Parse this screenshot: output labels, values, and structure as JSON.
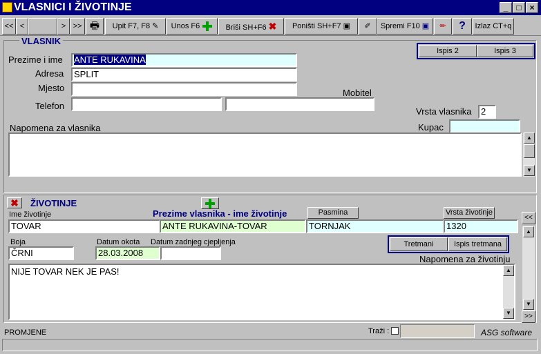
{
  "window": {
    "title": "VLASNICI I ŽIVOTINJE"
  },
  "toolbar": {
    "first": "<<",
    "prev": "<",
    "next": ">",
    "last": ">>",
    "query": "Upit F7, F8",
    "insert": "Unos F6",
    "delete": "Briši  SH+F6",
    "cancel": "Poništi SH+F7",
    "save": "Spremi F10",
    "exit": "Izlaz CT+q"
  },
  "owner": {
    "section": "VLASNIK",
    "print2": "Ispis 2",
    "print3": "Ispis 3",
    "name_label": "Prezime i ime",
    "name": "ANTE RUKAVINA",
    "address_label": "Adresa",
    "address": "SPLIT",
    "city_label": "Mjesto",
    "city": "",
    "mobile_label": "Mobitel",
    "phone_label": "Telefon",
    "phone": "",
    "mobile": "",
    "type_label": "Vrsta vlasnika",
    "type": "2",
    "buyer_label": "Kupac",
    "buyer": "",
    "note_label": "Napomena za vlasnika",
    "note": ""
  },
  "animals": {
    "section": "ŽIVOTINJE",
    "name_label": "Ime životinje",
    "name": "TOVAR",
    "owner_animal_label": "Prezime vlasnika - ime životinje",
    "owner_animal": "ANTE RUKAVINA-TOVAR",
    "breed_button": "Pasmina",
    "breed": "TORNJAK",
    "species_button": "Vrsta životinje",
    "species": "1320",
    "color_label": "Boja",
    "color": "ČRNI",
    "birth_label": "Datum okota",
    "birth": "28.03.2008",
    "vacc_label": "Datum zadnjeg cjepljenja",
    "vacc": "",
    "treatments": "Tretmani",
    "print_treatments": "Ispis tretmana",
    "note_label": "Napomena za životinju",
    "note": "NIJE TOVAR NEK JE PAS!",
    "nav_prev": "<<",
    "nav_next": ">>"
  },
  "status": {
    "changes": "PROMJENE",
    "search_label": "Traži :",
    "brand": "ASG software"
  }
}
